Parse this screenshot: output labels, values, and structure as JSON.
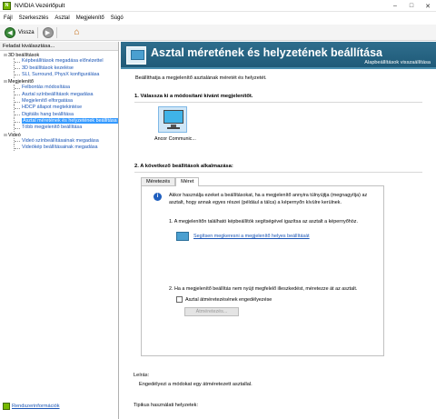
{
  "window": {
    "title": "NVIDIA Vezérlőpult",
    "app_icon": "nvidia-logo-icon"
  },
  "menu": [
    "Fájl",
    "Szerkesztés",
    "Asztal",
    "Megjelenítő",
    "Súgó"
  ],
  "toolbar": {
    "back_label": "Vissza"
  },
  "left": {
    "header": "Feladat kiválasztása...",
    "tree": [
      {
        "type": "cat",
        "label": "3D beállítások"
      },
      {
        "type": "leaf",
        "label": "Képbeállítások megadása előnézettel"
      },
      {
        "type": "leaf",
        "label": "3D beállítások kezelése"
      },
      {
        "type": "leaf",
        "label": "SLI, Surround, PhysX konfigurálása"
      },
      {
        "type": "cat",
        "label": "Megjelenítő"
      },
      {
        "type": "leaf",
        "label": "Felbontás módosítása"
      },
      {
        "type": "leaf",
        "label": "Asztal színbeállítások megadása"
      },
      {
        "type": "leaf",
        "label": "Megjelenítő elforgatása"
      },
      {
        "type": "leaf",
        "label": "HDCP állapot megtekintése"
      },
      {
        "type": "leaf",
        "label": "Digitális hang beállítása"
      },
      {
        "type": "leaf",
        "label": "Asztal méretének és helyzetének beállítása",
        "selected": true
      },
      {
        "type": "leaf",
        "label": "Több megjelenítő beállítása"
      },
      {
        "type": "cat",
        "label": "Videó"
      },
      {
        "type": "leaf",
        "label": "Videó színbeállításainak megadása"
      },
      {
        "type": "leaf",
        "label": "Videókép beállításainak megadása"
      }
    ],
    "system_info": "Rendszerinformációk"
  },
  "main": {
    "title": "Asztal méretének és helyzetének beállítása",
    "restore": "Alapbeállítások visszaállítása",
    "description": "Beállíthatja a megjelenítő asztalának méretét és helyzetét.",
    "section1": "1. Válassza ki a módosítani kívánt megjelenítőt.",
    "monitor_label": "Ancor Communic...",
    "section2": "2. A következő beállítások alkalmazása:",
    "tabs": [
      "Méretezés",
      "Méret"
    ],
    "active_tab": "Méret",
    "info": "Akkor használja ezeket a beállításokat, ha a megjelenítő annyira túlnyújtja (megnagyítja) az asztalt, hogy annak egyes részei (például a tálca) a képernyőn kívülre kerülnek.",
    "step1": "1. A megjelenítőn található képbeállítók segítségével igazítsa az asztalt a képernyőhöz.",
    "step1_link": "Segítsen megkeresni a megjelenítő helyes beállítását",
    "step2": "2. Ha a megjelenítő beállítás nem nyújt megfelelő illeszkedést, méretezze át az asztalt.",
    "checkbox_label": "Asztal átméretezésének engedélyezése",
    "checkbox_checked": false,
    "resize_button": "Átméretezés...",
    "desc_label": "Leírás:",
    "desc_text": "Engedélyezi a módokat egy átméretezett asztallal.",
    "tips_label": "Tipikus használati helyzetek:"
  }
}
